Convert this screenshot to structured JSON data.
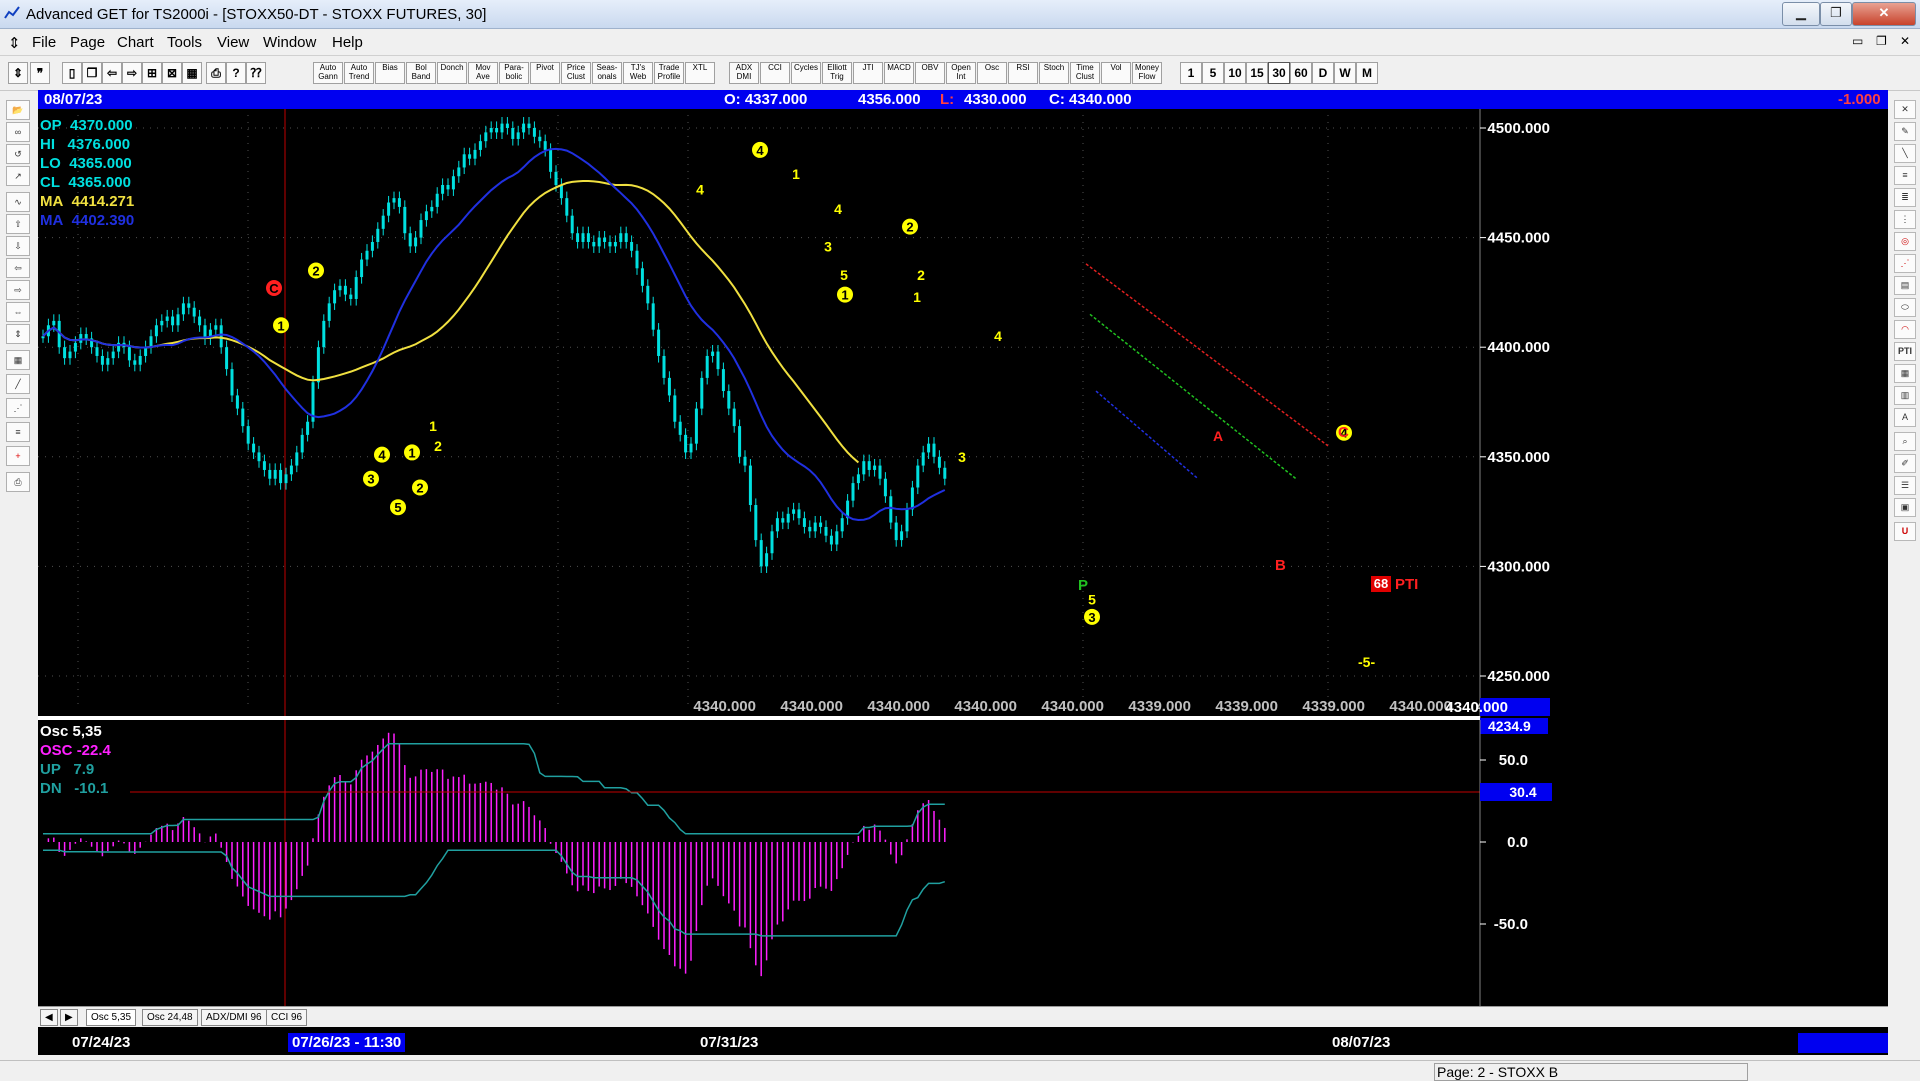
{
  "window": {
    "title": "Advanced GET for TS2000i - [STOXX50-DT - STOXX FUTURES, 30]"
  },
  "menu": [
    "File",
    "Page",
    "Chart",
    "Tools",
    "View",
    "Window",
    "Help"
  ],
  "toolbar": {
    "indicators": [
      "Auto Gann",
      "Auto Trend",
      "Bias",
      "Bol Band",
      "Donch",
      "Mov Ave",
      "Para-bolic",
      "Pivot",
      "Price Clust",
      "Seas-onals",
      "TJ's Web",
      "Trade Profile",
      "XTL",
      "ADX DMI",
      "CCI",
      "Cycles",
      "Elliott Trig",
      "JTI",
      "MACD",
      "OBV",
      "Open Int",
      "Osc",
      "RSI",
      "Stoch",
      "Time Clust",
      "Vol",
      "Money Flow"
    ],
    "intervals": [
      "1",
      "5",
      "10",
      "15",
      "30",
      "60",
      "D",
      "W",
      "M"
    ]
  },
  "infobar": {
    "date": "08/07/23",
    "open": "O: 4337.000",
    "high": "4356.000",
    "low_label": "L:",
    "low": "4330.000",
    "close": "C: 4340.000",
    "change": "-1.000"
  },
  "legend": {
    "op": {
      "label": "OP",
      "value": "4370.000"
    },
    "hi": {
      "label": "HI",
      "value": "4376.000"
    },
    "lo": {
      "label": "LO",
      "value": "4365.000"
    },
    "cl": {
      "label": "CL",
      "value": "4365.000"
    },
    "ma1": {
      "label": "MA",
      "value": "4414.271"
    },
    "ma2": {
      "label": "MA",
      "value": "4402.390"
    }
  },
  "price_axis": [
    "4500.000",
    "4450.000",
    "4400.000",
    "4350.000",
    "4300.000",
    "4250.000"
  ],
  "price_readouts": [
    "4340.000",
    "4340.000",
    "4340.000",
    "4340.000",
    "4340.000",
    "4339.000",
    "4339.000",
    "4339.000",
    "4340.000",
    "4340.000"
  ],
  "last_price": "4340.000",
  "cursor_price": "4234.9",
  "annotations": {
    "pti_value": "68",
    "pti_label": "PTI",
    "wave5_projection": "-5-",
    "p_label": "P",
    "a_label": "A",
    "b_label": "B",
    "c_label": "C"
  },
  "osc_panel": {
    "title": "Osc 5,35",
    "osc": {
      "label": "OSC",
      "value": "-22.4"
    },
    "up": {
      "label": "UP",
      "value": "7.9"
    },
    "dn": {
      "label": "DN",
      "value": "-10.1"
    },
    "axis": [
      "50.0",
      "0.0",
      "-50.0"
    ],
    "level": "30.4"
  },
  "tabs": [
    "Osc 5,35",
    "Osc 24,48",
    "ADX/DMI 96",
    "CCI 96"
  ],
  "dates": [
    "07/24/23",
    "07/26/23 - 11:30",
    "07/31/23",
    "08/07/23"
  ],
  "status": {
    "page": "Page: 2 - STOXX B"
  },
  "colors": {
    "candle": "#00e0e0",
    "ma_yellow": "#f0e040",
    "ma_blue": "#2030e0",
    "wave_yellow": "#ffff00",
    "wave_red": "#ff2020",
    "osc": "#ff20ff",
    "info_bar": "#0000f0"
  }
}
